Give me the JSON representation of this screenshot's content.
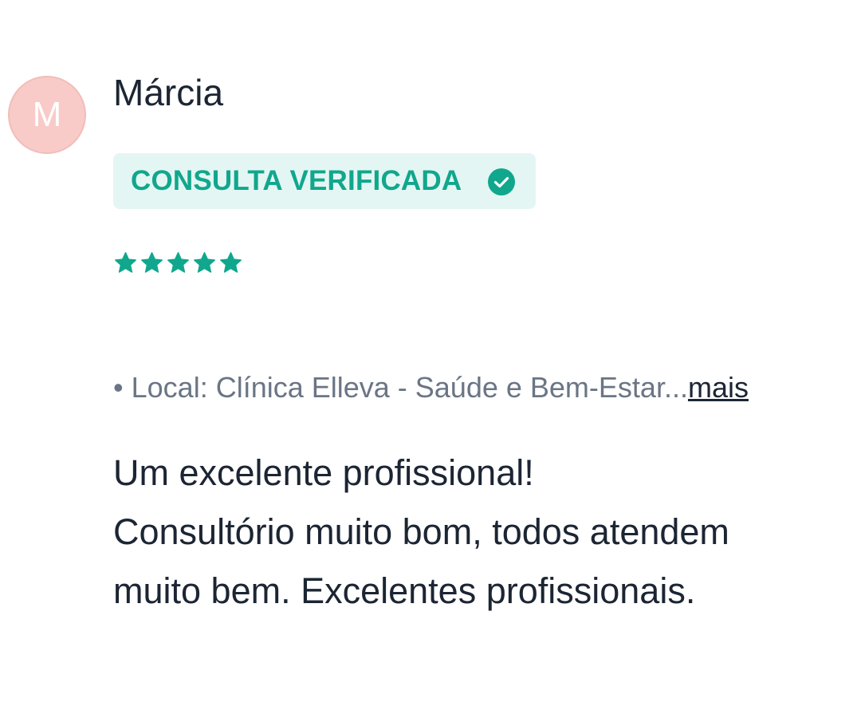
{
  "review": {
    "avatar_initial": "M",
    "author": "Márcia",
    "badge": {
      "label": "CONSULTA VERIFICADA",
      "icon": "check-circle-icon"
    },
    "rating": {
      "value": 5,
      "max": 5,
      "icon": "star-icon"
    },
    "location": {
      "bullet": "•",
      "text": "Local: Clínica Elleva - Saúde e Bem-Estar...",
      "more_label": "mais"
    },
    "body_lines": [
      "Um excelente profissional!",
      "Consultório muito bom, todos atendem",
      "muito bem. Excelentes profissionais."
    ]
  },
  "colors": {
    "accent": "#10a78d",
    "badge_bg": "#e4f6f3",
    "avatar_bg": "#f8cbc8",
    "text": "#1c2533",
    "muted": "#6a7585"
  }
}
